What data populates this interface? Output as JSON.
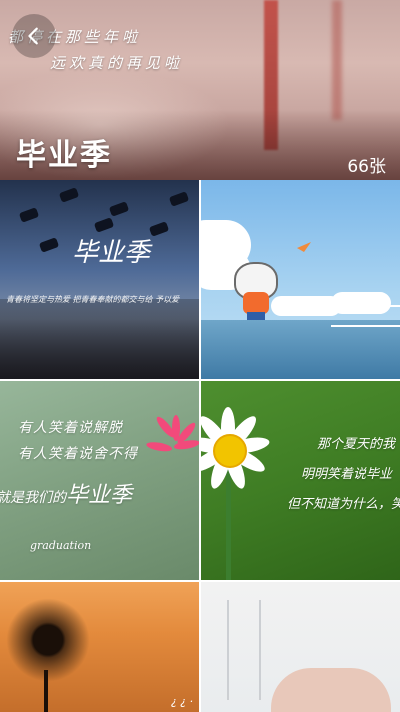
{
  "header": {
    "script_line1": "都停在那些年啦",
    "script_line2": "远欢真的再见啦",
    "album_title": "毕业季",
    "photo_count": "66张",
    "back_icon": "back-arrow-icon"
  },
  "tiles": [
    {
      "big_text": "毕业季",
      "small_text": "青春将坚定与热爱 把青春奉献的都交与给 予以爱"
    },
    {},
    {
      "line1": "有人笑着说解脱",
      "line2": "有人笑着说舍不得",
      "line3_prefix": "就是我们的",
      "line3_bold": "毕业季",
      "signature": "graduation"
    },
    {
      "line1": "那个夏天的我",
      "line2": "明明笑着说毕业",
      "line3": "但不知道为什么，笑着"
    },
    {
      "signature": "¿ ¿ ·"
    },
    {}
  ]
}
